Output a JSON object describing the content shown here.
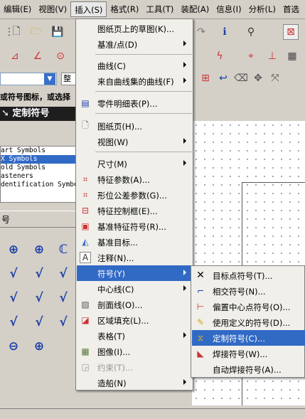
{
  "menubar": {
    "items": [
      {
        "label": "编辑(E)",
        "active": false
      },
      {
        "label": "视图(V)",
        "active": false
      },
      {
        "label": "插入(S)",
        "active": true
      },
      {
        "label": "格式(R)",
        "active": false
      },
      {
        "label": "工具(T)",
        "active": false
      },
      {
        "label": "装配(A)",
        "active": false
      },
      {
        "label": "信息(I)",
        "active": false
      },
      {
        "label": "分析(L)",
        "active": false
      },
      {
        "label": "首选",
        "active": false
      }
    ]
  },
  "left_panel": {
    "combo_value": "",
    "combo_right_label": "整",
    "hint_text": "或符号图标，或选择",
    "dialog_title": "定制符号",
    "symbol_list": [
      "art Symbols",
      "X Symbols",
      "old Symbols",
      "asteners",
      "dentification Symbo"
    ],
    "selected_index": 1,
    "group_label": "号",
    "symbols": [
      "⊕",
      "⊕",
      "ℂ",
      "√",
      "√",
      "√",
      "√",
      "√",
      "√",
      "√",
      "√",
      "√",
      "⊖",
      "⊕"
    ]
  },
  "insert_menu": {
    "items": [
      {
        "label": "图纸页上的草图(K)...",
        "icon": "sketch-icon",
        "submenu": false
      },
      {
        "label": "基准/点(D)",
        "icon": "",
        "submenu": true
      },
      {
        "label": "曲线(C)",
        "icon": "",
        "submenu": true
      },
      {
        "label": "来自曲线集的曲线(F)",
        "icon": "",
        "submenu": true
      },
      {
        "label": "零件明细表(P)...",
        "icon": "parts-list-icon",
        "submenu": false
      },
      {
        "label": "图纸页(H)...",
        "icon": "drawing-sheet-icon",
        "submenu": false
      },
      {
        "label": "视图(W)",
        "icon": "",
        "submenu": true
      },
      {
        "label": "尺寸(M)",
        "icon": "",
        "submenu": true
      },
      {
        "label": "特征参数(A)...",
        "icon": "feature-param-icon",
        "submenu": false
      },
      {
        "label": "形位公差参数(G)...",
        "icon": "gdt-param-icon",
        "submenu": false
      },
      {
        "label": "特征控制框(E)...",
        "icon": "feature-control-frame-icon",
        "submenu": false
      },
      {
        "label": "基准特征符号(R)...",
        "icon": "datum-feature-icon",
        "submenu": false
      },
      {
        "label": "基准目标...",
        "icon": "datum-target-icon",
        "submenu": false
      },
      {
        "label": "注释(N)...",
        "icon": "note-icon",
        "submenu": false
      },
      {
        "label": "符号(Y)",
        "icon": "",
        "submenu": true,
        "highlighted": true
      },
      {
        "label": "中心线(C)",
        "icon": "",
        "submenu": true
      },
      {
        "label": "剖面线(O)...",
        "icon": "hatch-icon",
        "submenu": false
      },
      {
        "label": "区域填充(L)...",
        "icon": "area-fill-icon",
        "submenu": false
      },
      {
        "label": "表格(T)",
        "icon": "",
        "submenu": true
      },
      {
        "label": "图像(I)...",
        "icon": "image-icon",
        "submenu": false
      },
      {
        "label": "约束(T)...",
        "icon": "constraint-icon",
        "submenu": false,
        "disabled": true
      },
      {
        "label": "造船(N)",
        "icon": "",
        "submenu": true
      }
    ]
  },
  "symbol_submenu": {
    "items": [
      {
        "label": "目标点符号(T)...",
        "icon": "target-point-icon"
      },
      {
        "label": "相交符号(N)...",
        "icon": "intersection-icon"
      },
      {
        "label": "偏置中心点符号(O)...",
        "icon": "offset-center-icon"
      },
      {
        "label": "使用定义的符号(D)...",
        "icon": "user-defined-symbol-icon"
      },
      {
        "label": "定制符号(C)...",
        "icon": "custom-symbol-icon",
        "highlighted": true
      },
      {
        "label": "焊接符号(W)...",
        "icon": "weld-symbol-icon"
      },
      {
        "label": "自动焊接符号(A)...",
        "icon": ""
      }
    ]
  },
  "colors": {
    "highlight": "#316ac5",
    "menu_bg": "#f0efea",
    "panel": "#d4d0c8"
  }
}
